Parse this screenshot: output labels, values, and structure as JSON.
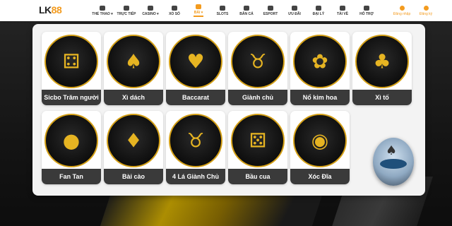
{
  "header": {
    "logo_text": "LK",
    "logo_num": "88",
    "nav": [
      {
        "label": "THỂ THAO ▾",
        "icon": "sports-icon",
        "active": false
      },
      {
        "label": "TRỰC TIẾP",
        "icon": "live-icon",
        "active": false
      },
      {
        "label": "CASINO ▾",
        "icon": "casino-icon",
        "active": false
      },
      {
        "label": "XỔ SỐ",
        "icon": "lottery-icon",
        "active": false
      },
      {
        "label": "BÀI ▾",
        "icon": "cards-icon",
        "active": true
      },
      {
        "label": "SLOTS",
        "icon": "slots-icon",
        "active": false
      },
      {
        "label": "BẮN CÁ",
        "icon": "fish-icon",
        "active": false
      },
      {
        "label": "ESPORT",
        "icon": "esport-icon",
        "active": false
      },
      {
        "label": "ƯU ĐÃI",
        "icon": "promo-icon",
        "active": false
      },
      {
        "label": "ĐẠI LÝ",
        "icon": "agent-icon",
        "active": false
      },
      {
        "label": "TẢI VỀ",
        "icon": "download-icon",
        "active": false
      },
      {
        "label": "HỖ TRỢ",
        "icon": "support-icon",
        "active": false
      }
    ],
    "login_label": "Đăng nhập",
    "register_label": "Đăng ký"
  },
  "games": [
    {
      "label": "Sicbo Trăm người",
      "icon": "dice-icon",
      "glyph": "⚃"
    },
    {
      "label": "Xì dách",
      "icon": "blackjack-icon",
      "glyph": "♠"
    },
    {
      "label": "Baccarat",
      "icon": "baccarat-icon",
      "glyph": "♥"
    },
    {
      "label": "Giành chủ",
      "icon": "bull-icon",
      "glyph": "♉"
    },
    {
      "label": "Nổ kim hoa",
      "icon": "flower-icon",
      "glyph": "✿"
    },
    {
      "label": "Xì tố",
      "icon": "poker-icon",
      "glyph": "♣"
    },
    {
      "label": "Fan Tan",
      "icon": "fantan-icon",
      "glyph": "●"
    },
    {
      "label": "Bài cào",
      "icon": "toad-icon",
      "glyph": "♦"
    },
    {
      "label": "4 Lá Giành Chủ",
      "icon": "ox-icon",
      "glyph": "♉"
    },
    {
      "label": "Bầu cua",
      "icon": "crab-icon",
      "glyph": "⚄"
    },
    {
      "label": "Xóc Đĩa",
      "icon": "coins-icon",
      "glyph": "◉"
    }
  ],
  "float_ad": {
    "icon": "casino-table-icon",
    "glyph": "♠"
  },
  "colors": {
    "accent": "#f39b1f",
    "label_bg": "#3a3a3a",
    "panel_bg": "#f3f3f3"
  }
}
